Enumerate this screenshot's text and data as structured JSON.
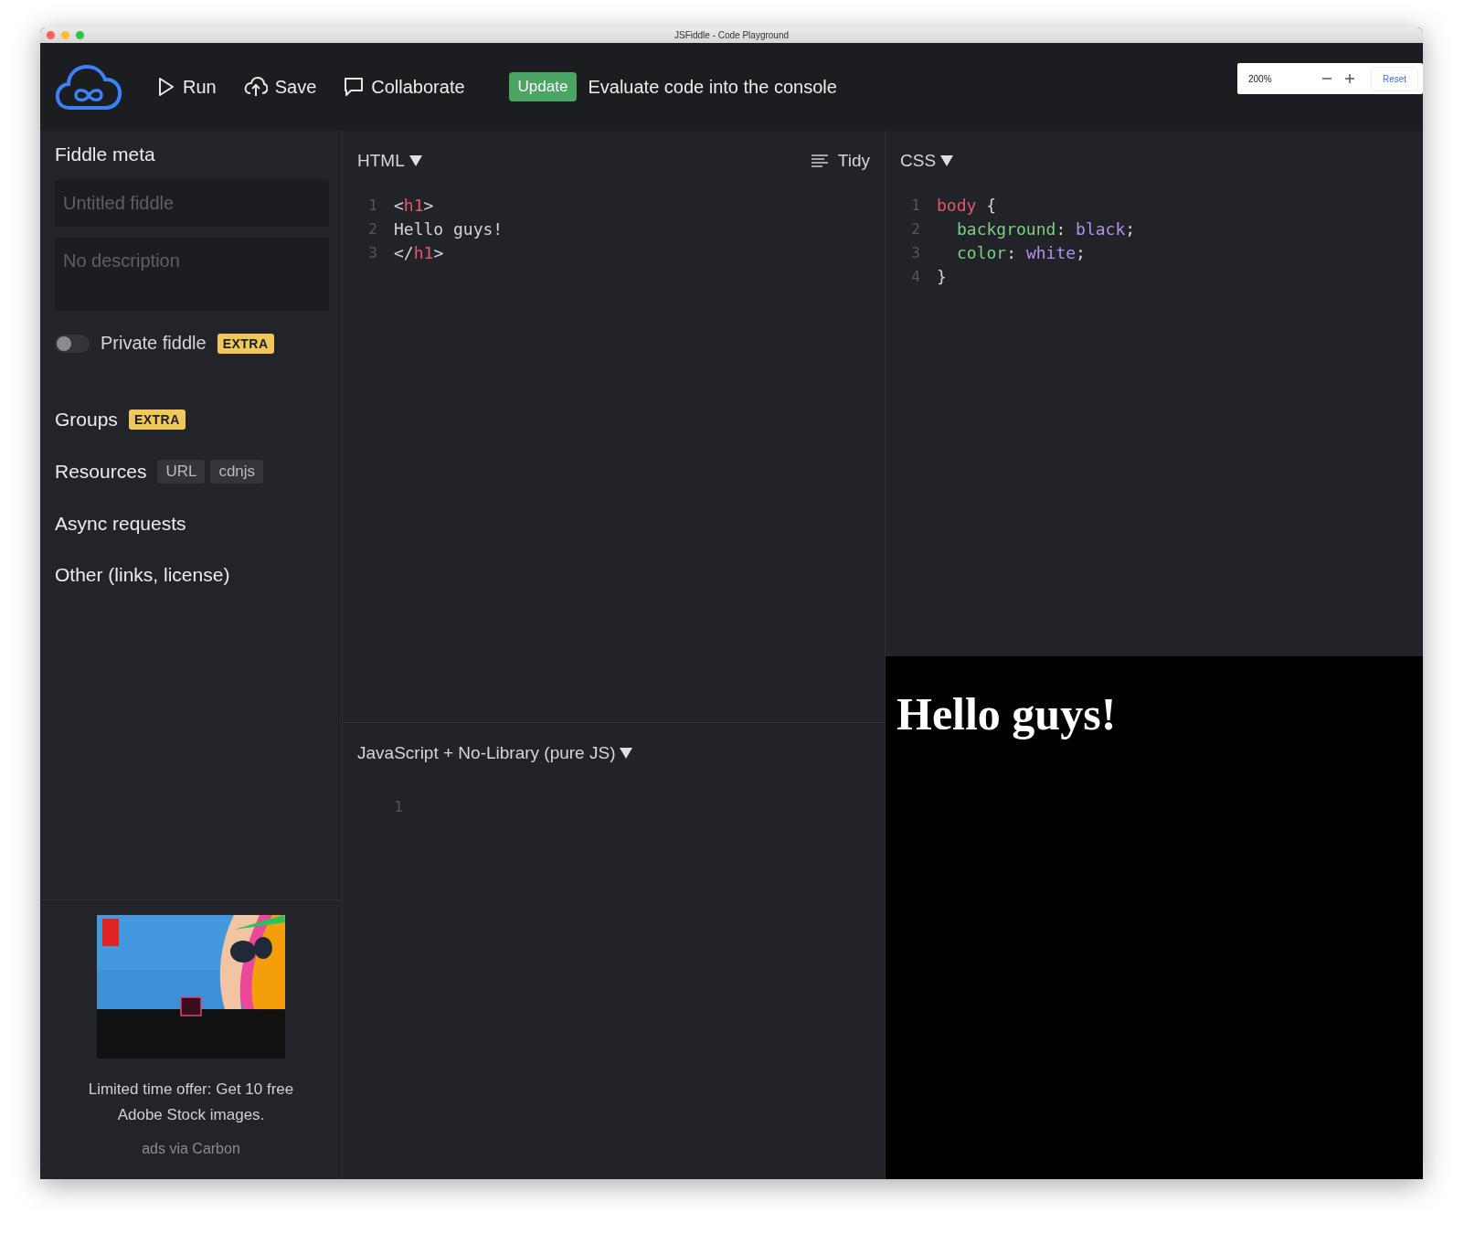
{
  "window": {
    "title": "JSFiddle - Code Playground"
  },
  "toolbar": {
    "buttons": [
      {
        "label": "Run",
        "kind": "run"
      },
      {
        "label": "Save",
        "kind": "save"
      },
      {
        "label": "Collaborate",
        "kind": "collaborate"
      }
    ],
    "update_button": "Update",
    "hint": "Evaluate code into the console"
  },
  "zoom_popup": {
    "value": "200%",
    "reset": "Reset"
  },
  "sidebar": {
    "title": "Fiddle meta",
    "title_field": {
      "placeholder": "Untitled fiddle"
    },
    "description_field": {
      "placeholder": "No description"
    },
    "private_toggle": {
      "label": "Private fiddle",
      "on": false,
      "badge": "EXTRA"
    },
    "sections": [
      {
        "label": "Groups",
        "badges": [
          {
            "text": "EXTRA",
            "kind": "extra"
          }
        ]
      },
      {
        "label": "Resources",
        "badges": [
          {
            "text": "URL",
            "kind": "tag"
          },
          {
            "text": "cdnjs",
            "kind": "tag"
          }
        ]
      },
      {
        "label": "Async requests"
      },
      {
        "label": "Other (links, license)"
      }
    ],
    "ad": {
      "text": "Limited time offer: Get 10 free Adobe Stock images.",
      "via": "ads via Carbon"
    }
  },
  "html_editor": {
    "language": "HTML",
    "tidy": "Tidy",
    "lines": [
      {
        "number": "1",
        "indented": false,
        "tokens": [
          {
            "text": "<",
            "kind": "punct"
          },
          {
            "text": "h1",
            "kind": "tag"
          },
          {
            "text": ">",
            "kind": "punct"
          }
        ]
      },
      {
        "number": "2",
        "indented": false,
        "tokens": [
          {
            "text": "Hello guys!",
            "kind": "plain"
          }
        ]
      },
      {
        "number": "3",
        "indented": false,
        "tokens": [
          {
            "text": "</",
            "kind": "punct"
          },
          {
            "text": "h1",
            "kind": "tag"
          },
          {
            "text": ">",
            "kind": "punct"
          }
        ]
      }
    ]
  },
  "css_editor": {
    "language": "CSS",
    "lines": [
      {
        "number": "1",
        "indented": false,
        "tokens": [
          {
            "text": "body",
            "kind": "tag"
          },
          {
            "text": " {",
            "kind": "punct"
          }
        ]
      },
      {
        "number": "2",
        "indented": true,
        "tokens": [
          {
            "text": "background",
            "kind": "property"
          },
          {
            "text": ": ",
            "kind": "punct"
          },
          {
            "text": "black",
            "kind": "value"
          },
          {
            "text": ";",
            "kind": "punct"
          }
        ]
      },
      {
        "number": "3",
        "indented": true,
        "tokens": [
          {
            "text": "color",
            "kind": "property"
          },
          {
            "text": ": ",
            "kind": "punct"
          },
          {
            "text": "white",
            "kind": "value"
          },
          {
            "text": ";",
            "kind": "punct"
          }
        ]
      },
      {
        "number": "4",
        "indented": false,
        "tokens": [
          {
            "text": "}",
            "kind": "punct"
          }
        ]
      }
    ]
  },
  "js_editor": {
    "language": "JavaScript + No-Library (pure JS)",
    "lines": [
      {
        "number": "1"
      }
    ]
  },
  "result": {
    "heading": "Hello guys!"
  }
}
